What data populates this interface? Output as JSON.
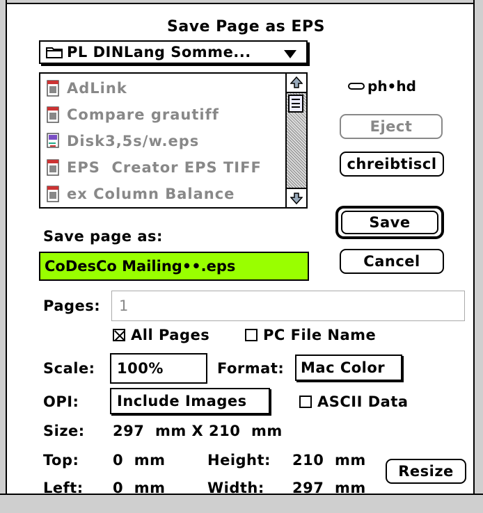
{
  "dialog": {
    "title": "Save Page as EPS"
  },
  "folder_popup": {
    "label": "PL DINLang Somme..."
  },
  "file_list": {
    "items": [
      {
        "name": "AdLink",
        "icon": "document-icon"
      },
      {
        "name": "Compare grautiff",
        "icon": "document-icon"
      },
      {
        "name": "Disk3,5s/w.eps",
        "icon": "eps-document-icon"
      },
      {
        "name": "EPS  Creator EPS TIFF",
        "icon": "document-icon"
      },
      {
        "name": "ex Column Balance",
        "icon": "document-icon"
      }
    ]
  },
  "disk": {
    "name": "ph•hd"
  },
  "buttons": {
    "eject": "Eject",
    "desktop": "chreibtiscl",
    "save": "Save",
    "cancel": "Cancel",
    "resize": "Resize"
  },
  "save_as": {
    "label": "Save page as:",
    "value": "CoDesCo Mailing••.eps"
  },
  "pages": {
    "label": "Pages:",
    "value": "1"
  },
  "options": {
    "all_pages": "All Pages",
    "all_pages_checked": true,
    "pc_file_name": "PC File Name",
    "pc_file_name_checked": false
  },
  "scale": {
    "label": "Scale:",
    "value": "100%"
  },
  "format": {
    "label": "Format:",
    "value": "Mac Color"
  },
  "opi": {
    "label": "OPI:",
    "value": "Include Images"
  },
  "ascii": {
    "label": "ASCII Data",
    "checked": false
  },
  "size": {
    "label": "Size:",
    "value": "297  mm X 210  mm"
  },
  "top": {
    "label": "Top:",
    "value": "0  mm"
  },
  "left": {
    "label": "Left:",
    "value": "0  mm"
  },
  "height": {
    "label": "Height:",
    "value": "210  mm"
  },
  "width": {
    "label": "Width:",
    "value": "297  mm"
  },
  "colors": {
    "highlight": "#99ff00",
    "frame": "#cfcfcf"
  }
}
